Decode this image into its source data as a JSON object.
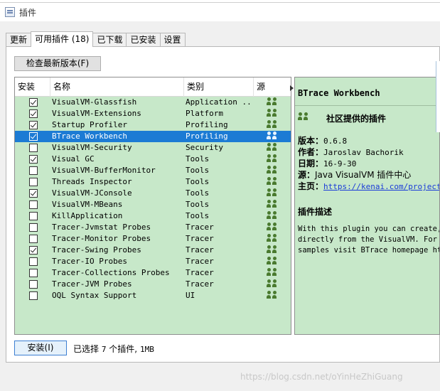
{
  "window": {
    "title": "插件",
    "app_icon": "plugin-window-icon"
  },
  "tabs": [
    {
      "label": "更新",
      "active": false
    },
    {
      "label": "可用插件 (18)",
      "active": true
    },
    {
      "label": "已下载",
      "active": false
    },
    {
      "label": "已安装",
      "active": false
    },
    {
      "label": "设置",
      "active": false
    }
  ],
  "check_button": "检查最新版本(F)",
  "table": {
    "headers": {
      "install": "安装",
      "name": "名称",
      "category": "类别",
      "source": "源"
    },
    "source_icon": "community-people-icon",
    "rows": [
      {
        "checked": true,
        "name": "VisualVM-Glassfish",
        "category": "Application ...",
        "selected": false
      },
      {
        "checked": true,
        "name": "VisualVM-Extensions",
        "category": "Platform",
        "selected": false
      },
      {
        "checked": true,
        "name": "Startup Profiler",
        "category": "Profiling",
        "selected": false
      },
      {
        "checked": true,
        "name": "BTrace Workbench",
        "category": "Profiling",
        "selected": true
      },
      {
        "checked": false,
        "name": "VisualVM-Security",
        "category": "Security",
        "selected": false
      },
      {
        "checked": true,
        "name": "Visual GC",
        "category": "Tools",
        "selected": false
      },
      {
        "checked": false,
        "name": "VisualVM-BufferMonitor",
        "category": "Tools",
        "selected": false
      },
      {
        "checked": false,
        "name": "Threads Inspector",
        "category": "Tools",
        "selected": false
      },
      {
        "checked": true,
        "name": "VisualVM-JConsole",
        "category": "Tools",
        "selected": false
      },
      {
        "checked": false,
        "name": "VisualVM-MBeans",
        "category": "Tools",
        "selected": false
      },
      {
        "checked": false,
        "name": "KillApplication",
        "category": "Tools",
        "selected": false
      },
      {
        "checked": false,
        "name": "Tracer-Jvmstat Probes",
        "category": "Tracer",
        "selected": false
      },
      {
        "checked": false,
        "name": "Tracer-Monitor Probes",
        "category": "Tracer",
        "selected": false
      },
      {
        "checked": true,
        "name": "Tracer-Swing Probes",
        "category": "Tracer",
        "selected": false
      },
      {
        "checked": false,
        "name": "Tracer-IO Probes",
        "category": "Tracer",
        "selected": false
      },
      {
        "checked": false,
        "name": "Tracer-Collections Probes",
        "category": "Tracer",
        "selected": false
      },
      {
        "checked": false,
        "name": "Tracer-JVM Probes",
        "category": "Tracer",
        "selected": false
      },
      {
        "checked": false,
        "name": "OQL Syntax Support",
        "category": "UI",
        "selected": false
      }
    ]
  },
  "detail": {
    "title": "BTrace Workbench",
    "community_label": "社区提供的插件",
    "version_label": "版本：",
    "version": "0.6.8",
    "author_label": "作者：",
    "author": "Jaroslav Bachorik",
    "date_label": "日期：",
    "date": "16-9-30",
    "source_label": "源：",
    "source": "Java VisualVM 插件中心",
    "homepage_label": "主页：",
    "homepage": "https://kenai.com/projects",
    "desc_title": "插件描述",
    "desc_lines": [
      "With this plugin you can create,",
      "directly from the VisualVM. For m",
      "samples visit BTrace homepage htt"
    ]
  },
  "install_button": "安装(I)",
  "status": {
    "prefix": "已选择",
    "count": "7",
    "middle": "个插件,",
    "size": "1MB"
  },
  "watermark": "https://blog.csdn.net/oYinHeZhiGuang",
  "colors": {
    "panel_bg": "#c7e8c9",
    "selection": "#1c7bd4",
    "link": "#1a3bd8"
  }
}
